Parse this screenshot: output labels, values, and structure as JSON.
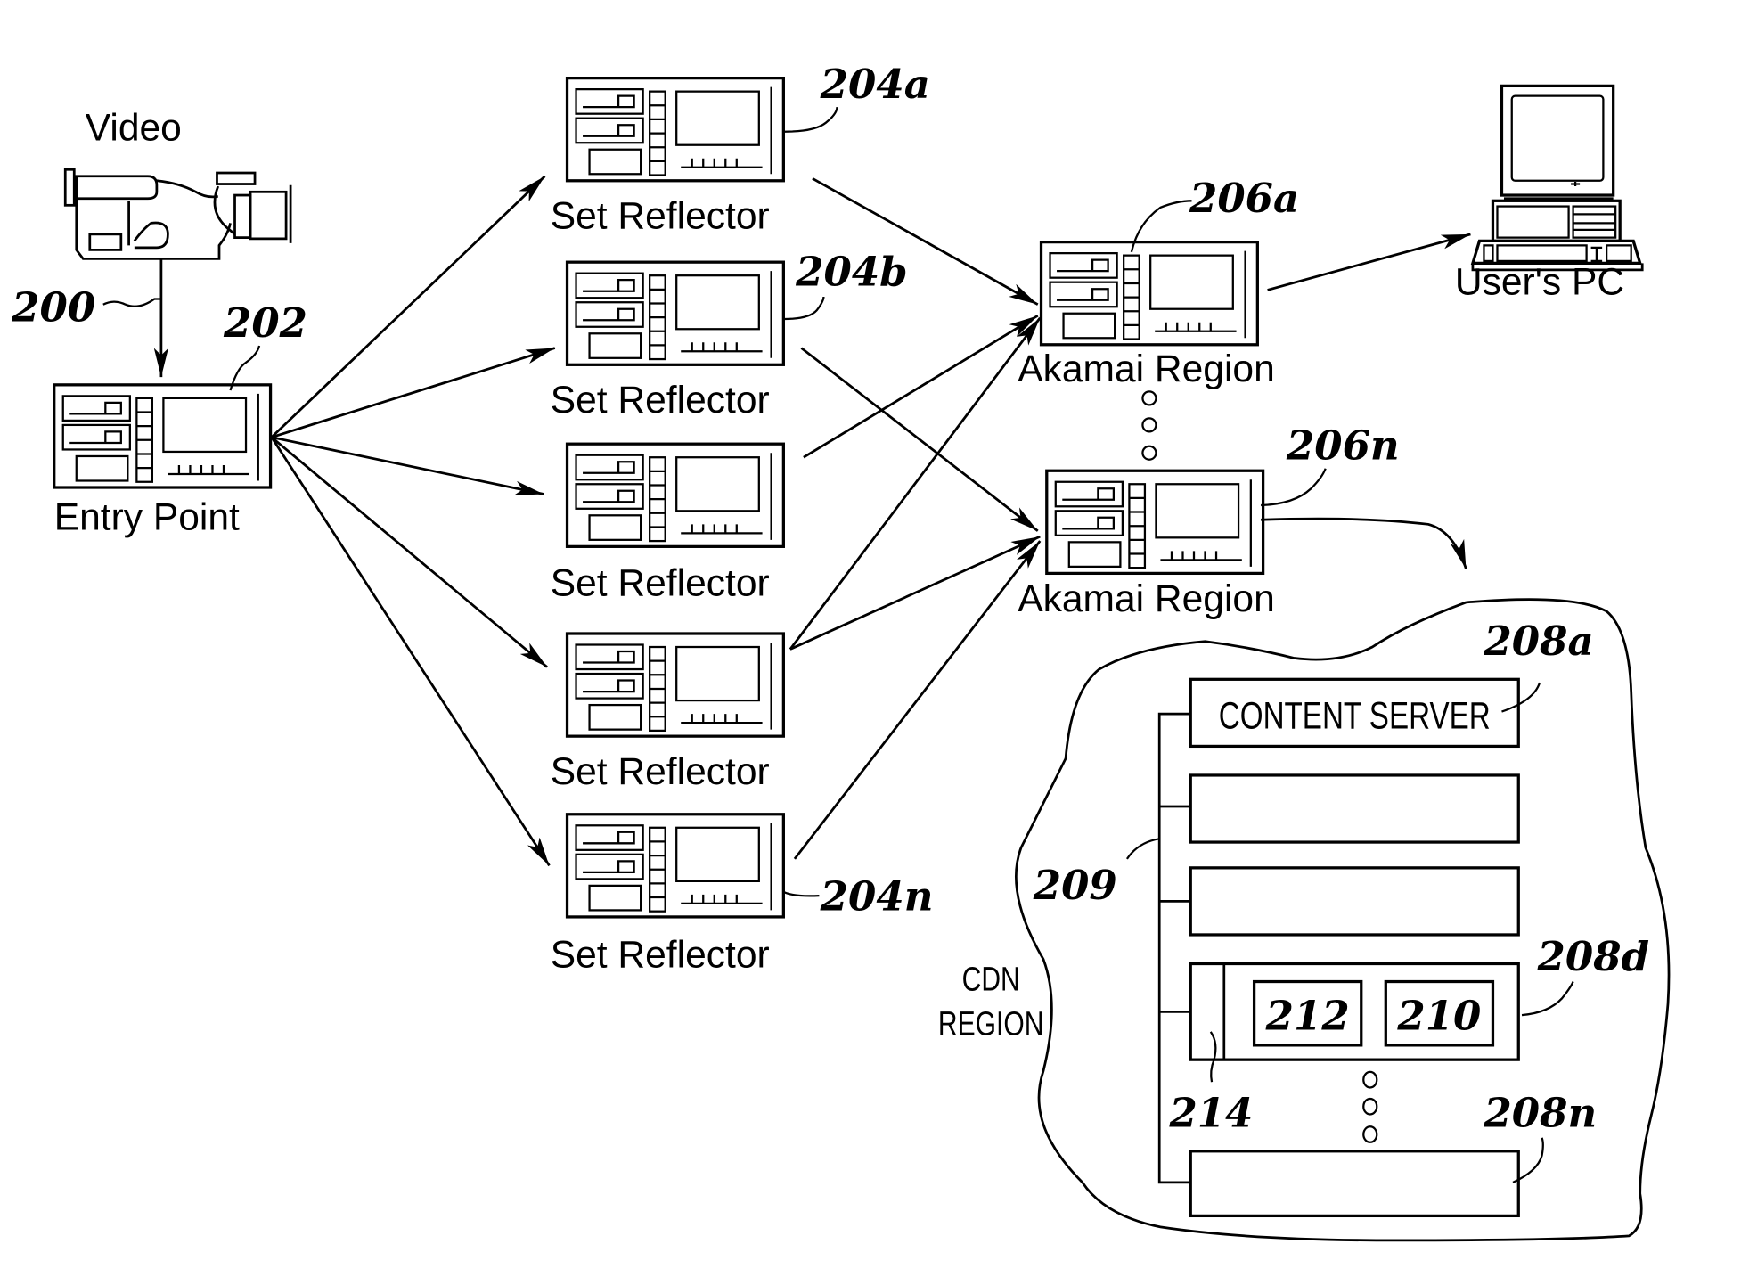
{
  "figure": {
    "source": {
      "label": "Video",
      "ref": "200"
    },
    "entry_point": {
      "label": "Entry Point",
      "ref": "202"
    },
    "set_reflectors": [
      {
        "label": "Set Reflector",
        "ref": "204a"
      },
      {
        "label": "Set Reflector",
        "ref": "204b"
      },
      {
        "label": "Set Reflector",
        "ref": ""
      },
      {
        "label": "Set Reflector",
        "ref": ""
      },
      {
        "label": "Set Reflector",
        "ref": "204n"
      }
    ],
    "akamai_regions": [
      {
        "label": "Akamai Region",
        "ref": "206a"
      },
      {
        "label": "Akamai Region",
        "ref": "206n"
      }
    ],
    "user_pc": {
      "label": "User's PC"
    },
    "cdn_region": {
      "label_line1": "CDN",
      "label_line2": "REGION",
      "bus_ref": "209",
      "servers": [
        {
          "label": "CONTENT SERVER",
          "ref": "208a"
        },
        {
          "label": "",
          "ref": ""
        },
        {
          "label": "",
          "ref": ""
        },
        {
          "label": "",
          "ref": "208d",
          "inner": [
            "212",
            "210"
          ],
          "side_ref": "214"
        },
        {
          "label": "",
          "ref": "208n"
        }
      ]
    }
  }
}
